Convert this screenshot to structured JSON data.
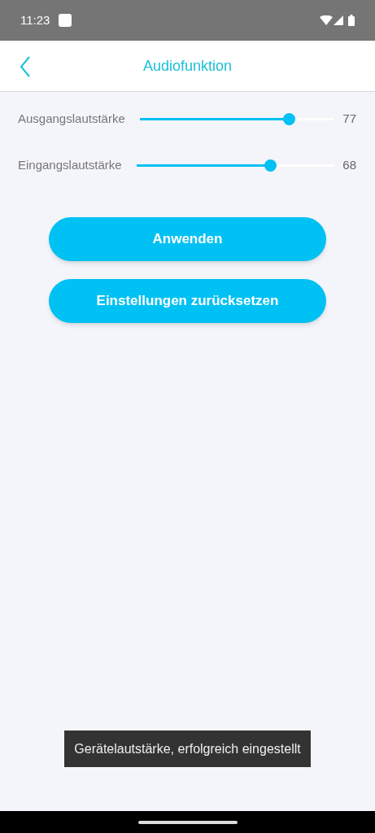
{
  "status_bar": {
    "time": "11:23"
  },
  "header": {
    "title": "Audiofunktion"
  },
  "sliders": [
    {
      "label": "Ausgangslautstärke",
      "level": 0.77,
      "reading": "77"
    },
    {
      "label": "Eingangslautstärke",
      "level": 0.68,
      "reading": "68"
    }
  ],
  "buttons": [
    "Anwenden",
    "Einstellungen zurücksetzen"
  ],
  "toast": "Gerätelautstärke, erfolgreich eingestellt"
}
